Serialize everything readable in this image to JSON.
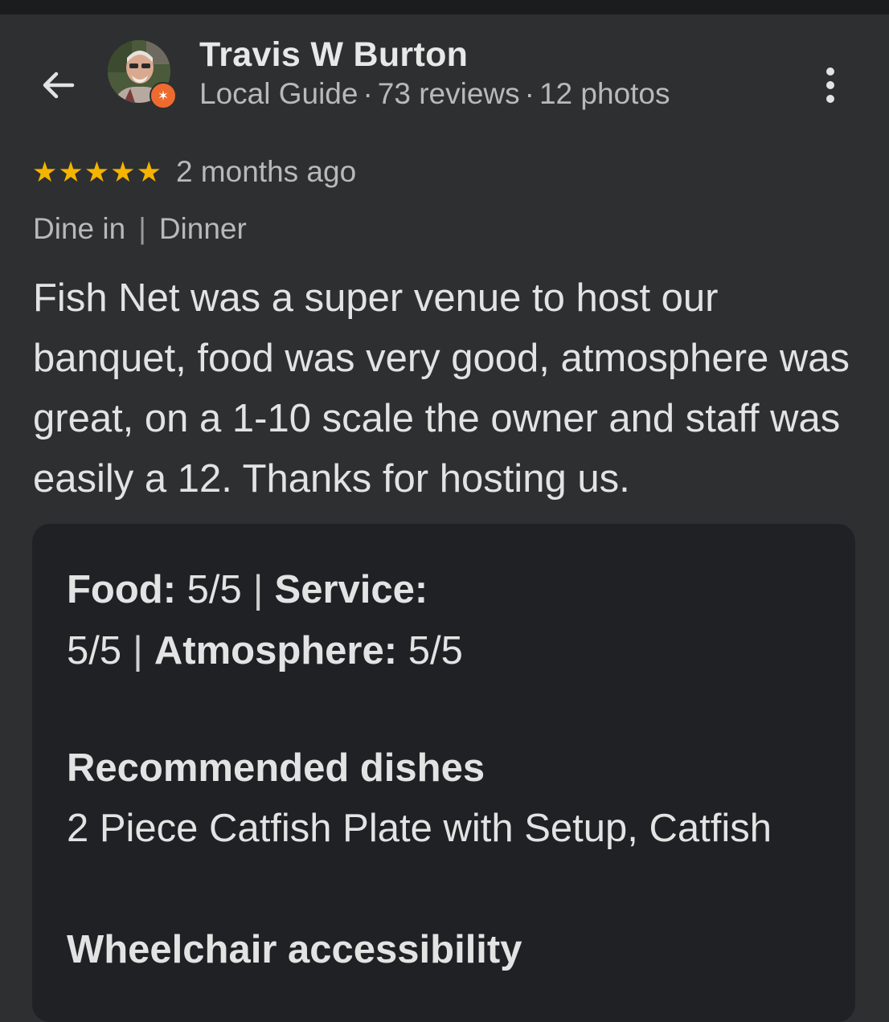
{
  "reviewer": {
    "name": "Travis W Burton",
    "level": "Local Guide",
    "reviews": "73 reviews",
    "photos": "12 photos",
    "separator": "·"
  },
  "review": {
    "stars": 5,
    "time": "2 months ago",
    "tags": [
      "Dine in",
      "Dinner"
    ],
    "tag_separator": "|",
    "text": "Fish Net was a super venue to host our banquet, food was very good, atmosphere was great, on a 1-10 scale the owner and staff was easily a 12. Thanks for hosting us."
  },
  "ratings": {
    "food_label": "Food:",
    "food_value": "5/5",
    "service_label": "Service:",
    "service_value": "5/5",
    "atmosphere_label": "Atmosphere:",
    "atmosphere_value": "5/5",
    "separator": "|"
  },
  "recommended": {
    "title": "Recommended dishes",
    "dishes": "2 Piece Catfish Plate with Setup, Catfish"
  },
  "accessibility": {
    "title": "Wheelchair accessibility"
  },
  "colors": {
    "background": "#2e2f31",
    "card": "#202124",
    "star": "#f5b400",
    "badge": "#ee6b2f"
  },
  "icons": {
    "back": "back-arrow-icon",
    "more": "more-vert-icon",
    "badge": "local-guide-badge-icon",
    "star": "star-icon"
  }
}
